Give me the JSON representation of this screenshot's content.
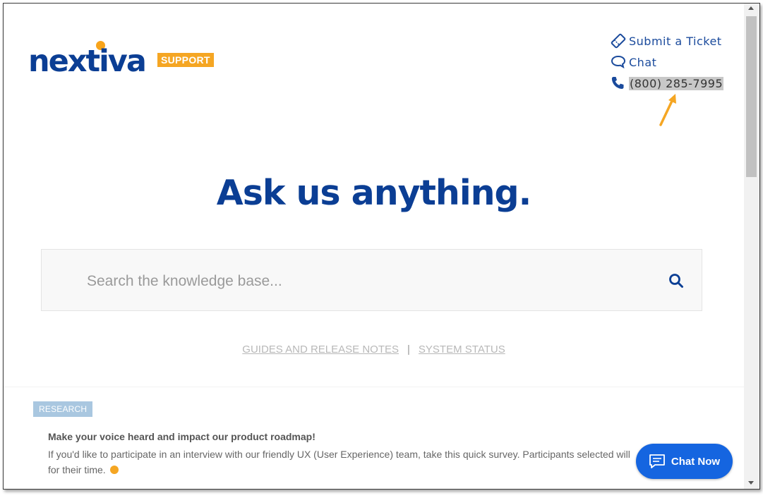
{
  "logo": {
    "word": "nextiva",
    "badge": "SUPPORT"
  },
  "top_links": {
    "submit_ticket": "Submit a Ticket",
    "chat": "Chat",
    "phone": "(800) 285-7995"
  },
  "hero": {
    "heading": "Ask us anything."
  },
  "search": {
    "placeholder": "Search the knowledge base..."
  },
  "links": {
    "guides": "GUIDES AND RELEASE NOTES",
    "separator": "|",
    "status": "SYSTEM STATUS"
  },
  "research": {
    "tag": "RESEARCH",
    "title": "Make your voice heard and impact our product roadmap!",
    "body": "If you'd like to participate in an interview with our friendly UX (User Experience) team, take this quick survey. Participants selected will",
    "body_end": "for their time."
  },
  "chat_widget": {
    "label": "Chat Now"
  },
  "colors": {
    "brand_blue": "#0b3e94",
    "accent_orange": "#f5a623",
    "chat_blue": "#1565e0"
  }
}
